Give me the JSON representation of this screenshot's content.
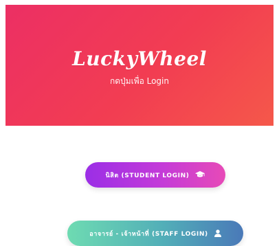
{
  "hero": {
    "brand": "LuckyWheel",
    "subtitle": "กดปุ่มเพื่อ Login"
  },
  "buttons": {
    "student": {
      "label": "นิสิต (STUDENT LOGIN)",
      "icon": "graduation-cap-icon"
    },
    "staff": {
      "label": "อาจารย์ - เจ้าหน้าที่ (STAFF LOGIN)",
      "icon": "user-icon"
    }
  },
  "colors": {
    "hero_start": "#ec2f64",
    "hero_end": "#f5584a",
    "student_start": "#9b2ee6",
    "student_end": "#e74ab7",
    "staff_start": "#6edbb2",
    "staff_end": "#4a79b8"
  }
}
